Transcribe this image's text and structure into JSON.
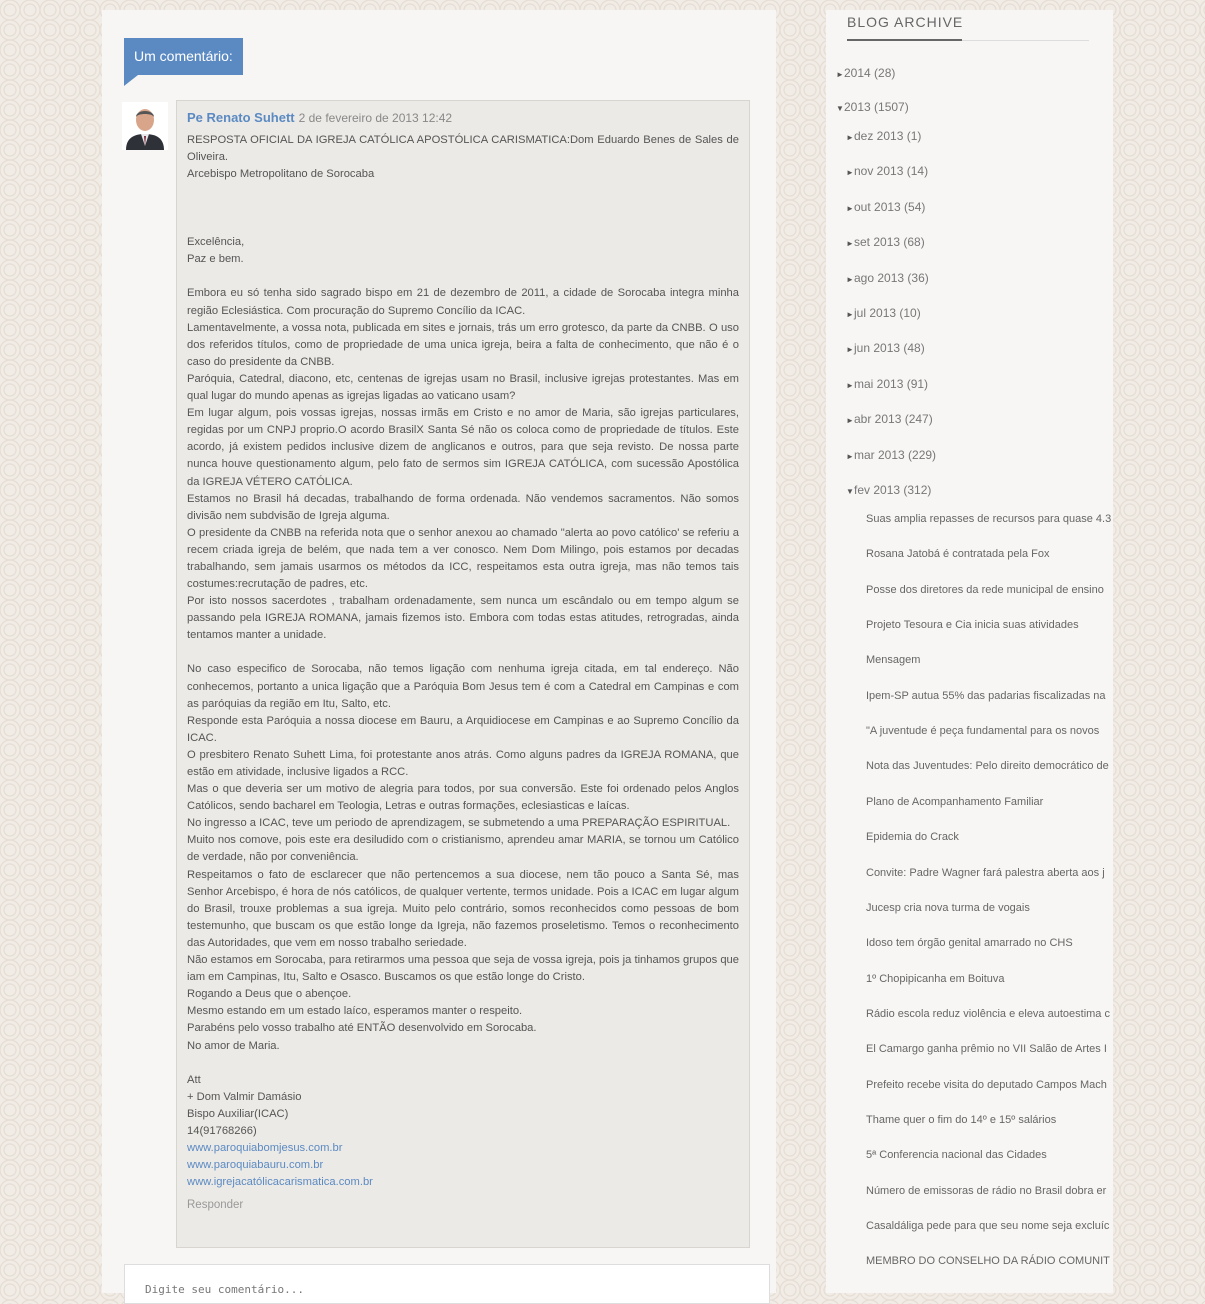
{
  "comments": {
    "header": "Um comentário:",
    "author": "Pe Renato Suhett",
    "date": "2 de fevereiro de 2013 12:42",
    "paragraphs": [
      {
        "t": "RESPOSTA OFICIAL DA IGREJA CATÓLICA APOSTÓLICA CARISMATICA:Dom Eduardo Benes de Sales de Oliveira."
      },
      {
        "t": "Arcebispo Metropolitano de Sorocaba"
      },
      {
        "gap": "big"
      },
      {
        "t": "Excelência,"
      },
      {
        "t": "Paz e bem."
      },
      {
        "gap": "small"
      },
      {
        "t": "Embora eu só tenha sido sagrado bispo em 21 de dezembro de 2011, a cidade de Sorocaba integra minha região Eclesiástica. Com procuração do Supremo Concílio da ICAC."
      },
      {
        "t": "Lamentavelmente, a vossa nota, publicada em sites e jornais, trás um erro grotesco, da parte da CNBB. O uso dos referidos títulos, como de propriedade de uma unica igreja, beira a falta de conhecimento, que não é o caso do presidente da CNBB."
      },
      {
        "t": "Paróquia, Catedral, diacono, etc, centenas de igrejas usam no Brasil, inclusive igrejas protestantes. Mas em qual lugar do mundo apenas as igrejas ligadas ao vaticano usam?"
      },
      {
        "t": "Em lugar algum, pois vossas igrejas, nossas irmãs em Cristo e no amor de Maria, são igrejas particulares, regidas por um CNPJ proprio.O acordo BrasilX Santa Sé não os coloca como de propriedade de títulos. Este acordo, já existem pedidos inclusive dizem de anglicanos e outros, para que seja revisto. De nossa parte nunca houve questionamento algum, pelo fato de sermos sim IGREJA CATÓLICA, com sucessão Apostólica da IGREJA VÉTERO CATÓLICA."
      },
      {
        "t": "Estamos no Brasil há decadas, trabalhando de forma ordenada. Não vendemos sacramentos. Não somos divisão nem subdvisão de Igreja alguma."
      },
      {
        "t": "O presidente da CNBB na referida nota que o senhor anexou ao chamado \"alerta ao povo católico' se referiu a recem criada igreja de belém, que nada tem a ver conosco. Nem Dom Milingo, pois estamos por decadas trabalhando, sem jamais usarmos os métodos da ICC, respeitamos esta outra igreja, mas não temos tais costumes:recrutação de padres, etc."
      },
      {
        "t": "Por isto nossos sacerdotes , trabalham ordenadamente, sem nunca um escândalo ou em tempo algum se passando pela IGREJA ROMANA, jamais fizemos isto. Embora com todas estas atitudes, retrogradas, ainda tentamos manter a unidade."
      },
      {
        "gap": "small"
      },
      {
        "t": "No caso especifico de Sorocaba, não temos ligação com nenhuma igreja citada, em tal endereço. Não conhecemos, portanto a unica ligação que a Paróquia Bom Jesus tem é com a Catedral em Campinas e com as paróquias da região em Itu, Salto, etc."
      },
      {
        "t": "Responde esta Paróquia a nossa diocese em Bauru, a Arquidiocese em Campinas e ao Supremo Concílio da ICAC."
      },
      {
        "t": "O presbitero Renato Suhett Lima, foi protestante anos atrás. Como alguns padres da IGREJA ROMANA, que estão em atividade, inclusive ligados a RCC."
      },
      {
        "t": "Mas o que deveria ser um motivo de alegria para todos, por sua conversão. Este foi ordenado pelos Anglos Católicos, sendo bacharel em Teologia, Letras e outras formações, eclesiasticas e laícas."
      },
      {
        "t": "No ingresso a ICAC, teve um periodo de aprendizagem, se submetendo a uma PREPARAÇÃO ESPIRITUAL."
      },
      {
        "t": "Muito nos comove, pois este era desiludido com o cristianismo, aprendeu amar MARIA, se tornou um Católico de verdade, não por conveniência."
      },
      {
        "t": "Respeitamos o fato de esclarecer que não pertencemos a sua diocese, nem tão pouco a Santa Sé, mas Senhor Arcebispo, é hora de nós católicos, de qualquer vertente, termos unidade. Pois a ICAC em lugar algum do Brasil, trouxe problemas a sua igreja. Muito pelo contrário, somos reconhecidos como pessoas de bom testemunho, que buscam os que estão longe da Igreja, não fazemos proseletismo. Temos o reconhecimento das Autoridades, que vem em nosso trabalho seriedade."
      },
      {
        "t": "Não estamos em Sorocaba, para retirarmos uma pessoa que seja de vossa igreja, pois ja tinhamos grupos que iam em Campinas, Itu, Salto e Osasco. Buscamos os que estão longe do Cristo."
      },
      {
        "t": "Rogando a Deus que o abençoe."
      },
      {
        "t": "Mesmo estando em um estado laíco, esperamos manter o respeito."
      },
      {
        "t": "Parabéns pelo vosso trabalho até ENTÃO desenvolvido em Sorocaba."
      },
      {
        "t": "No amor de Maria."
      },
      {
        "gap": "small"
      },
      {
        "t": "Att"
      },
      {
        "t": "+ Dom Valmir Damásio"
      },
      {
        "t": "Bispo Auxiliar(ICAC)"
      },
      {
        "t": "14(91768266)"
      }
    ],
    "links": [
      "www.paroquiabomjesus.com.br",
      "www.paroquiabauru.com.br",
      "www.igrejacatólicacarismatica.com.br"
    ],
    "reply_label": "Responder",
    "input_placeholder": "Digite seu comentário..."
  },
  "archive": {
    "title": "BLOG ARCHIVE",
    "years": [
      {
        "label": "2014",
        "count": "(28)",
        "expanded": false
      },
      {
        "label": "2013",
        "count": "(1507)",
        "expanded": true
      }
    ],
    "months": [
      {
        "label": "dez 2013",
        "count": "(1)"
      },
      {
        "label": "nov 2013",
        "count": "(14)"
      },
      {
        "label": "out 2013",
        "count": "(54)"
      },
      {
        "label": "set 2013",
        "count": "(68)"
      },
      {
        "label": "ago 2013",
        "count": "(36)"
      },
      {
        "label": "jul 2013",
        "count": "(10)"
      },
      {
        "label": "jun 2013",
        "count": "(48)"
      },
      {
        "label": "mai 2013",
        "count": "(91)"
      },
      {
        "label": "abr 2013",
        "count": "(247)"
      },
      {
        "label": "mar 2013",
        "count": "(229)"
      },
      {
        "label": "fev 2013",
        "count": "(312)",
        "expanded": true
      }
    ],
    "posts": [
      "Suas amplia repasses de recursos para quase 4.3",
      "Rosana Jatobá é contratada pela Fox",
      "Posse dos diretores da rede municipal de ensino",
      "Projeto Tesoura e Cia inicia suas atividades",
      "Mensagem",
      "Ipem-SP autua 55% das padarias fiscalizadas na",
      "\"A juventude é peça fundamental para os novos",
      "Nota das Juventudes: Pelo direito democrático de",
      "Plano de Acompanhamento Familiar",
      "Epidemia do Crack",
      "Convite: Padre Wagner fará palestra aberta aos j",
      "Jucesp cria nova turma de vogais",
      "Idoso tem órgão genital amarrado no CHS",
      "1º Chopipicanha em Boituva",
      "Rádio escola reduz violência e eleva autoestima c",
      "El Camargo ganha prêmio no VII Salão de Artes I",
      "Prefeito recebe visita do deputado Campos Mach",
      "Thame quer o fim do 14º e 15º salários",
      "5ª Conferencia nacional das Cidades",
      "Número de emissoras de rádio no Brasil dobra er",
      "Casaldáliga pede para que seu nome seja excluíc",
      "MEMBRO DO CONSELHO DA RÁDIO COMUNIT"
    ]
  }
}
